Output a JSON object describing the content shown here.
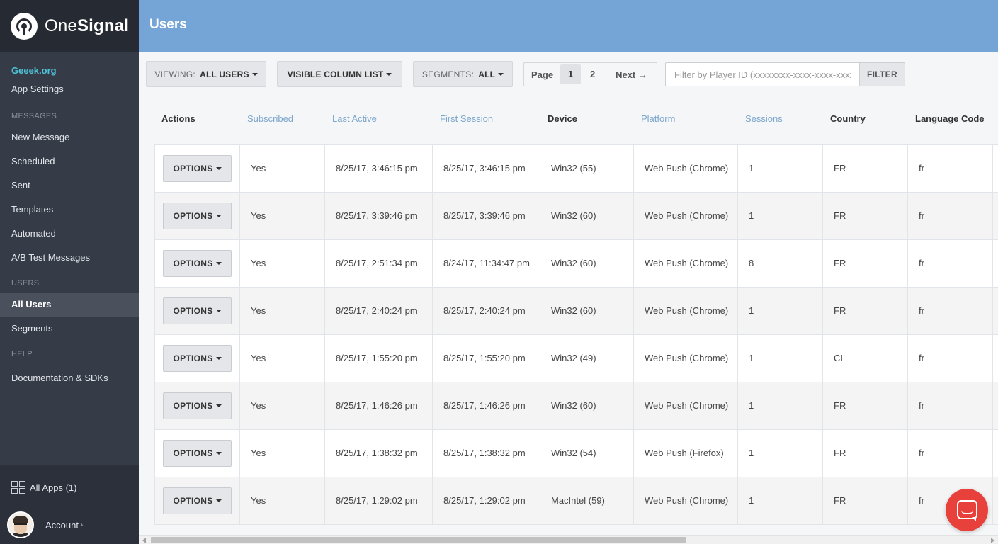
{
  "brand": {
    "name_light": "One",
    "name_bold": "Signal"
  },
  "sidebar": {
    "app_name": "Geeek.org",
    "app_settings": "App Settings",
    "messages_section": "MESSAGES",
    "messages_items": [
      "New Message",
      "Scheduled",
      "Sent",
      "Templates",
      "Automated",
      "A/B Test Messages"
    ],
    "users_section": "USERS",
    "users_items": [
      "All Users",
      "Segments"
    ],
    "active_item": "All Users",
    "help_section": "HELP",
    "help_items": [
      "Documentation & SDKs"
    ],
    "all_apps": "All Apps (1)",
    "account": "Account"
  },
  "header": {
    "title": "Users"
  },
  "toolbar": {
    "viewing_label": "VIEWING:",
    "viewing_value": "ALL USERS",
    "columns_label": "VISIBLE COLUMN LIST",
    "segments_label": "SEGMENTS:",
    "segments_value": "ALL",
    "page_label": "Page",
    "pages": [
      "1",
      "2"
    ],
    "current_page": "1",
    "next_label": "Next →",
    "filter_placeholder": "Filter by Player ID (xxxxxxxx-xxxx-xxxx-xxxx",
    "filter_button": "FILTER"
  },
  "table": {
    "columns": [
      "Actions",
      "Subscribed",
      "Last Active",
      "First Session",
      "Device",
      "Platform",
      "Sessions",
      "Country",
      "Language Code"
    ],
    "sortable_columns": [
      "Subscribed",
      "Last Active",
      "First Session",
      "Platform",
      "Sessions"
    ],
    "options_label": "OPTIONS",
    "rows": [
      [
        "Yes",
        "8/25/17, 3:46:15 pm",
        "8/25/17, 3:46:15 pm",
        "Win32 (55)",
        "Web Push (Chrome)",
        "1",
        "FR",
        "fr"
      ],
      [
        "Yes",
        "8/25/17, 3:39:46 pm",
        "8/25/17, 3:39:46 pm",
        "Win32 (60)",
        "Web Push (Chrome)",
        "1",
        "FR",
        "fr"
      ],
      [
        "Yes",
        "8/25/17, 2:51:34 pm",
        "8/24/17, 11:34:47 pm",
        "Win32 (60)",
        "Web Push (Chrome)",
        "8",
        "FR",
        "fr"
      ],
      [
        "Yes",
        "8/25/17, 2:40:24 pm",
        "8/25/17, 2:40:24 pm",
        "Win32 (60)",
        "Web Push (Chrome)",
        "1",
        "FR",
        "fr"
      ],
      [
        "Yes",
        "8/25/17, 1:55:20 pm",
        "8/25/17, 1:55:20 pm",
        "Win32 (49)",
        "Web Push (Chrome)",
        "1",
        "CI",
        "fr"
      ],
      [
        "Yes",
        "8/25/17, 1:46:26 pm",
        "8/25/17, 1:46:26 pm",
        "Win32 (60)",
        "Web Push (Chrome)",
        "1",
        "FR",
        "fr"
      ],
      [
        "Yes",
        "8/25/17, 1:38:32 pm",
        "8/25/17, 1:38:32 pm",
        "Win32 (54)",
        "Web Push (Firefox)",
        "1",
        "FR",
        "fr"
      ],
      [
        "Yes",
        "8/25/17, 1:29:02 pm",
        "8/25/17, 1:29:02 pm",
        "MacIntel (59)",
        "Web Push (Chrome)",
        "1",
        "FR",
        "fr"
      ]
    ]
  },
  "colors": {
    "header": "#75a4d6",
    "sidebar": "#353b47",
    "accent": "#4fc3d9",
    "chat": "#e8413c"
  }
}
